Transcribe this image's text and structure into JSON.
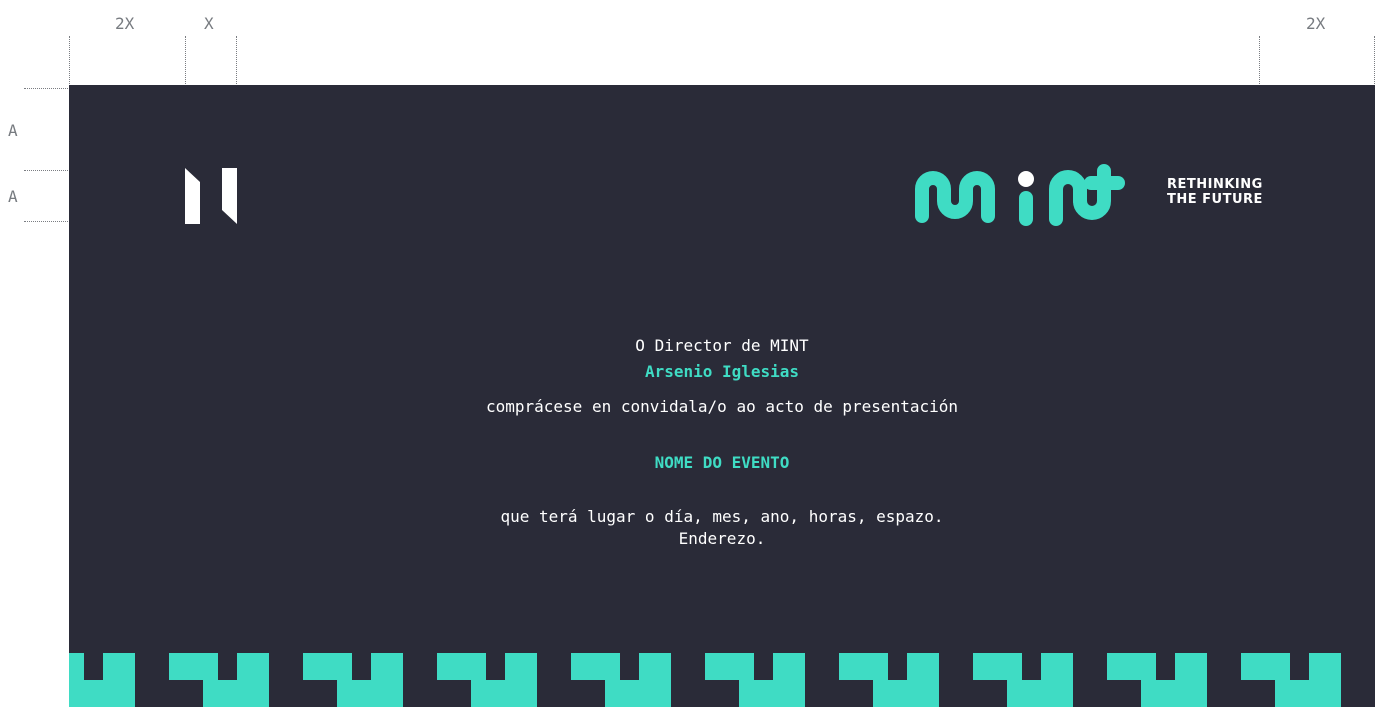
{
  "guides": {
    "left_2x": "2X",
    "x": "X",
    "right_2x": "2X",
    "a_top": "A",
    "a_bottom": "A"
  },
  "brand": {
    "accent_color": "#3fdcc4",
    "background_color": "#2a2b38",
    "logo_icon": "mint-wordmark-icon",
    "mark_icon": "brand-mark-icon",
    "tagline_line1": "RETHINKING",
    "tagline_line2": "THE FUTURE"
  },
  "invitation": {
    "line1": "O Director de MINT",
    "name": "Arsenio Iglesias",
    "line2": "comprácese en convidala/o ao acto de presentación",
    "event_name": "NOME DO EVENTO",
    "details": "que terá lugar o día, mes, ano, horas, espazo.",
    "address": "Enderezo."
  }
}
